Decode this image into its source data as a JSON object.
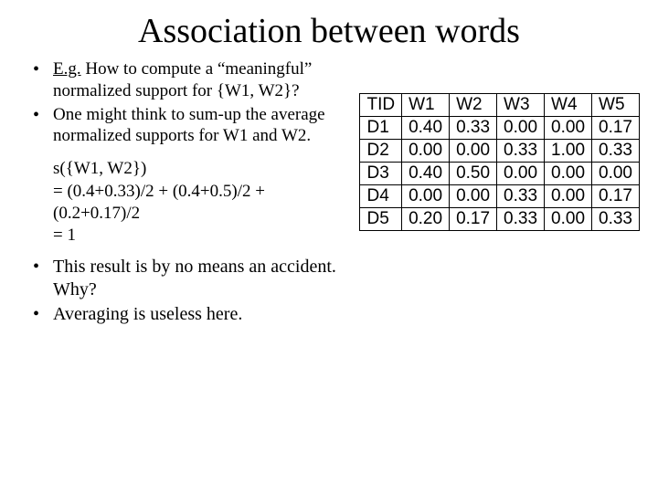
{
  "title": "Association between words",
  "bullets": {
    "b1_prefix": "E.g.",
    "b1_body_a": " How to compute a “meaningful” normalized support for {W",
    "b1_body_b": "1, W",
    "b1_body_c": "2}?",
    "b2_a": "One might think to sum-up the average normalized supports for W",
    "b2_b": " and W",
    "b2_c": ".",
    "w1_sub": "1",
    "w2_sub": "2",
    "calc_l1": "s({W1, W2})",
    "calc_l2": "= (0.4+0.33)/2 + (0.4+0.5)/2  + (0.2+0.17)/2",
    "calc_l3": "= 1",
    "b3": "This result is by no means an accident. Why?",
    "b4": "Averaging is useless here."
  },
  "chart_data": {
    "type": "table",
    "headers": [
      "TID",
      "W1",
      "W2",
      "W3",
      "W4",
      "W5"
    ],
    "rows": [
      [
        "D1",
        "0.40",
        "0.33",
        "0.00",
        "0.00",
        "0.17"
      ],
      [
        "D2",
        "0.00",
        "0.00",
        "0.33",
        "1.00",
        "0.33"
      ],
      [
        "D3",
        "0.40",
        "0.50",
        "0.00",
        "0.00",
        "0.00"
      ],
      [
        "D4",
        "0.00",
        "0.00",
        "0.33",
        "0.00",
        "0.17"
      ],
      [
        "D5",
        "0.20",
        "0.17",
        "0.33",
        "0.00",
        "0.33"
      ]
    ]
  }
}
